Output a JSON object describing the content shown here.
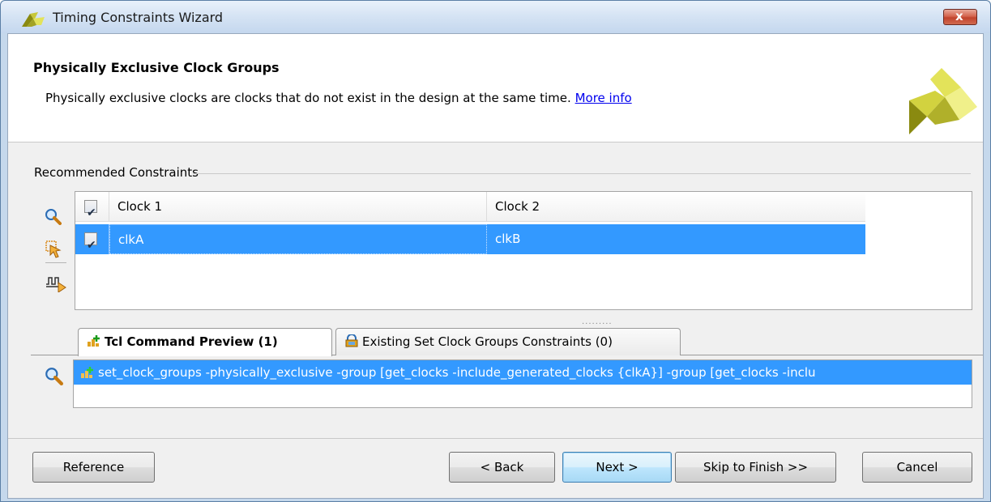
{
  "window": {
    "title": "Timing Constraints Wizard",
    "close_label": "x"
  },
  "header": {
    "title": "Physically Exclusive Clock Groups",
    "description": "Physically exclusive clocks are clocks that do not exist in the design at the same time.",
    "more_info_link": "More info"
  },
  "recommended": {
    "label": "Recommended Constraints",
    "columns": [
      "Clock 1",
      "Clock 2"
    ],
    "header_checked": true,
    "rows": [
      {
        "checked": true,
        "clock1": "clkA",
        "clock2": "clkB",
        "selected": true
      }
    ],
    "side_icons": [
      "search-icon",
      "select-cursor-icon",
      "timing-waveform-icon"
    ],
    "splitter": "........."
  },
  "tabs": [
    {
      "label": "Tcl Command Preview (1)",
      "icon": "add-constraint-icon",
      "active": true
    },
    {
      "label": "Existing Set Clock Groups Constraints (0)",
      "icon": "existing-constraints-icon",
      "active": false
    }
  ],
  "preview": {
    "command": "set_clock_groups -physically_exclusive -group [get_clocks -include_generated_clocks {clkA}] -group [get_clocks -inclu"
  },
  "buttons": {
    "reference": "Reference",
    "back": "< Back",
    "next": "Next >",
    "skip": "Skip to Finish >>",
    "cancel": "Cancel"
  },
  "colors": {
    "selection": "#3399ff",
    "title_bar": "#d6e4f4",
    "close_button": "#c1432c",
    "link": "#0000ee",
    "logo_dark": "#8a8a10",
    "logo_light": "#e3e35a"
  }
}
